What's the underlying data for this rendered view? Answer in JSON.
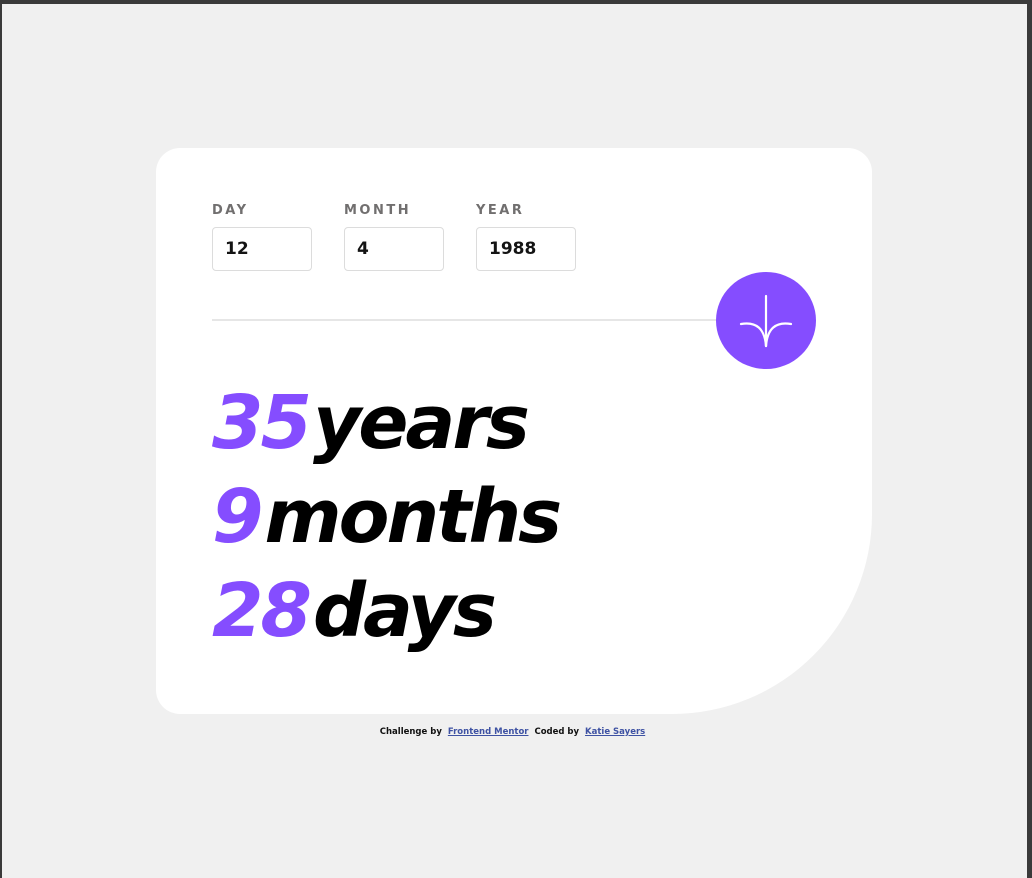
{
  "form": {
    "day": {
      "label": "DAY",
      "value": "12"
    },
    "month": {
      "label": "MONTH",
      "value": "4"
    },
    "year": {
      "label": "YEAR",
      "value": "1988"
    }
  },
  "submit": {
    "icon": "arrow-down-icon"
  },
  "results": {
    "years": {
      "value": "35",
      "unit": "years"
    },
    "months": {
      "value": "9",
      "unit": "months"
    },
    "days": {
      "value": "28",
      "unit": "days"
    }
  },
  "attribution": {
    "challenge_prefix": "Challenge by",
    "challenge_link": "Frontend Mentor",
    "coded_prefix": "Coded by",
    "coded_link": "Katie Sayers"
  },
  "colors": {
    "accent": "#854dff",
    "background": "#f0f0f0",
    "card": "#ffffff",
    "label": "#716f6f",
    "link": "#3e52a3"
  }
}
